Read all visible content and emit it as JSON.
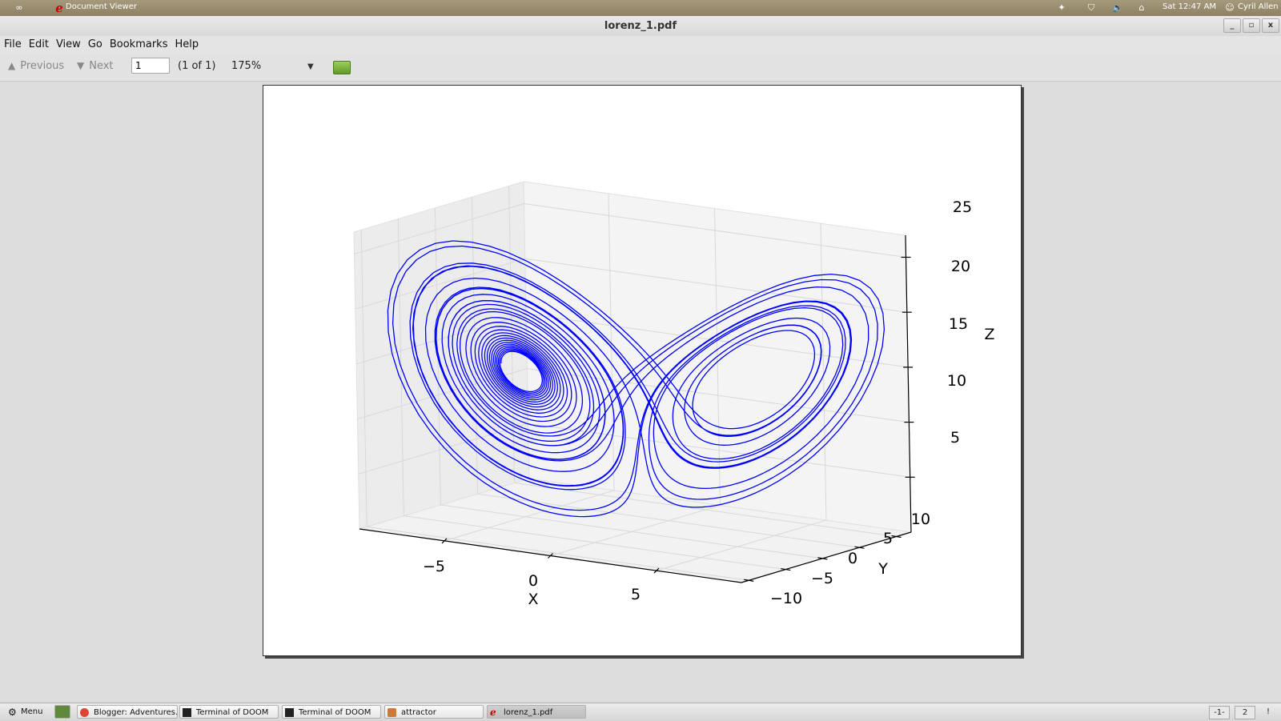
{
  "top_panel": {
    "app_label": "Document Viewer",
    "clock": "Sat 12:47 AM",
    "user": "Cyril Allen"
  },
  "window": {
    "title": "lorenz_1.pdf",
    "controls": [
      "_",
      "▫",
      "x"
    ]
  },
  "menu": [
    "File",
    "Edit",
    "View",
    "Go",
    "Bookmarks",
    "Help"
  ],
  "toolbar": {
    "previous_label": "Previous",
    "next_label": "Next",
    "page_value": "1",
    "page_count": "(1 of 1)",
    "zoom": "175%"
  },
  "chart_data": {
    "type": "line",
    "projection": "3d",
    "title": "",
    "series_color": "#0000ff",
    "xlabel": "X",
    "ylabel": "Y",
    "zlabel": "Z",
    "xticks": [
      "−5",
      "0",
      "5"
    ],
    "yticks": [
      "−10",
      "−5",
      "0",
      "5",
      "10"
    ],
    "zticks": [
      "5",
      "10",
      "15",
      "20",
      "25"
    ],
    "xlim": [
      -9,
      9
    ],
    "ylim": [
      -11,
      12
    ],
    "zlim": [
      0,
      27
    ],
    "grid": true
  },
  "taskbar": {
    "menu_label": "Menu",
    "tasks": [
      "Blogger: Adventures...",
      "Terminal of DOOM",
      "Terminal of DOOM",
      "attractor",
      "lorenz_1.pdf"
    ],
    "pager": [
      "-1-",
      "2"
    ],
    "tray": "!"
  }
}
